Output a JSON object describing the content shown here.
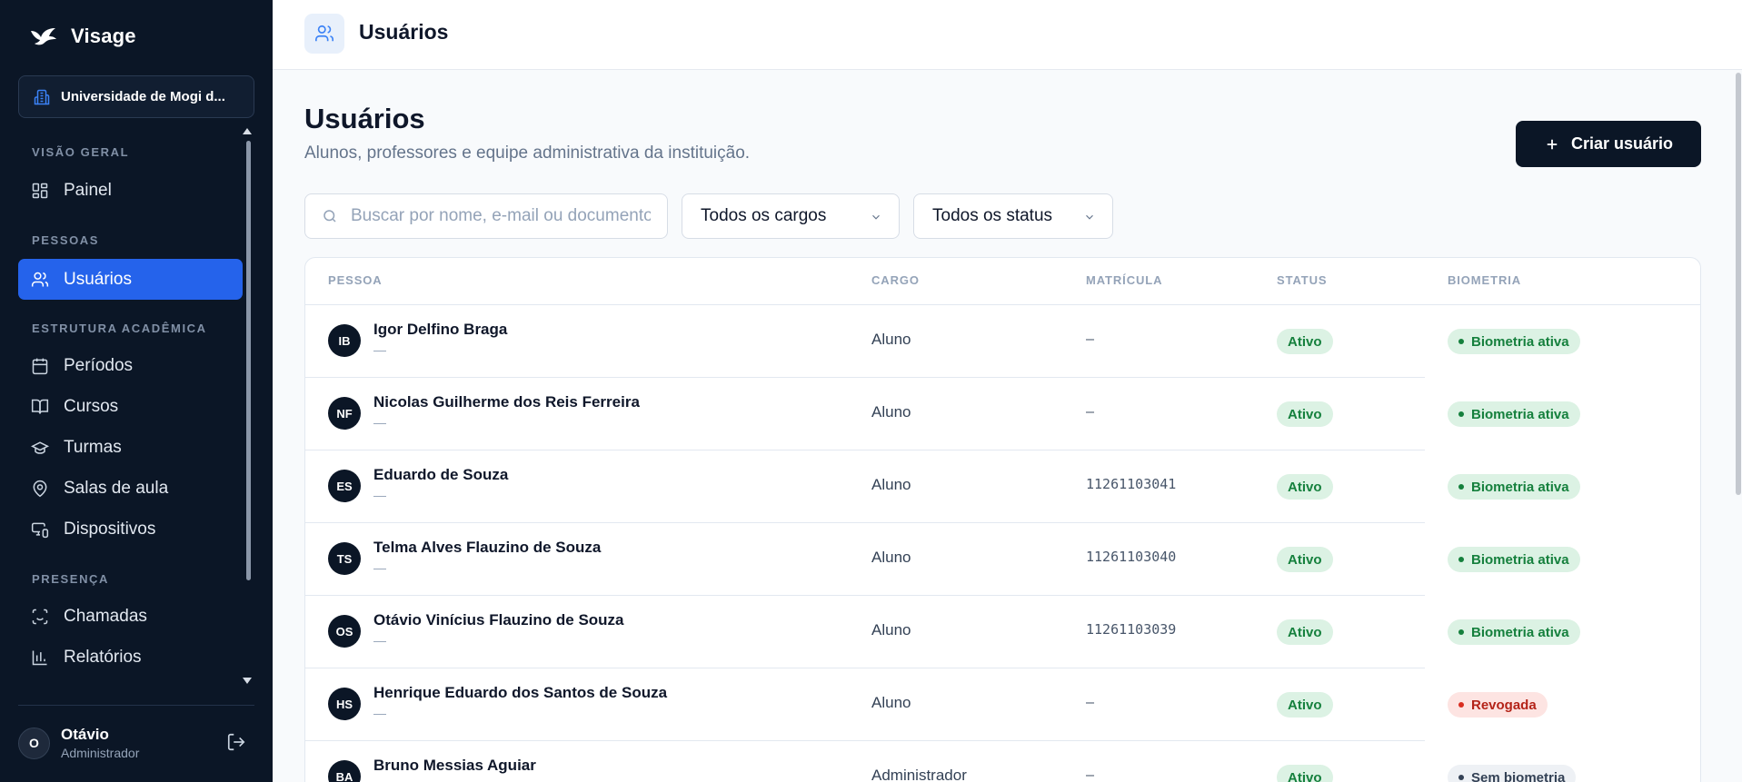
{
  "brand": {
    "name": "Visage"
  },
  "org": {
    "name": "Universidade de Mogi d..."
  },
  "sidebar": {
    "sections": [
      {
        "label": "VISÃO GERAL",
        "items": [
          {
            "label": "Painel",
            "icon": "grid-icon"
          }
        ]
      },
      {
        "label": "PESSOAS",
        "items": [
          {
            "label": "Usuários",
            "icon": "users-icon",
            "active": true
          }
        ]
      },
      {
        "label": "ESTRUTURA ACADÊMICA",
        "items": [
          {
            "label": "Períodos",
            "icon": "calendar-icon"
          },
          {
            "label": "Cursos",
            "icon": "book-icon"
          },
          {
            "label": "Turmas",
            "icon": "graduation-cap-icon"
          },
          {
            "label": "Salas de aula",
            "icon": "map-pin-icon"
          },
          {
            "label": "Dispositivos",
            "icon": "devices-icon"
          }
        ]
      },
      {
        "label": "PRESENÇA",
        "items": [
          {
            "label": "Chamadas",
            "icon": "face-scan-icon"
          },
          {
            "label": "Relatórios",
            "icon": "bar-chart-icon"
          }
        ]
      }
    ]
  },
  "user": {
    "initial": "O",
    "name": "Otávio",
    "role": "Administrador"
  },
  "topbar": {
    "title": "Usuários"
  },
  "page": {
    "title": "Usuários",
    "subtitle": "Alunos, professores e equipe administrativa da instituição.",
    "create_label": "Criar usuário"
  },
  "filters": {
    "search_placeholder": "Buscar por nome, e-mail ou documento",
    "cargo_value": "Todos os cargos",
    "status_value": "Todos os status"
  },
  "table": {
    "headers": {
      "pessoa": "PESSOA",
      "cargo": "CARGO",
      "matricula": "MATRÍCULA",
      "status": "STATUS",
      "biometria": "BIOMETRIA"
    },
    "rows": [
      {
        "initials": "IB",
        "name": "Igor Delfino Braga",
        "email": "—",
        "cargo": "Aluno",
        "matricula": "–",
        "status": "Ativo",
        "biometria": "Biometria ativa",
        "bio_kind": "ok"
      },
      {
        "initials": "NF",
        "name": "Nicolas Guilherme dos Reis Ferreira",
        "email": "—",
        "cargo": "Aluno",
        "matricula": "–",
        "status": "Ativo",
        "biometria": "Biometria ativa",
        "bio_kind": "ok"
      },
      {
        "initials": "ES",
        "name": "Eduardo de Souza",
        "email": "—",
        "cargo": "Aluno",
        "matricula": "11261103041",
        "status": "Ativo",
        "biometria": "Biometria ativa",
        "bio_kind": "ok"
      },
      {
        "initials": "TS",
        "name": "Telma Alves Flauzino de Souza",
        "email": "—",
        "cargo": "Aluno",
        "matricula": "11261103040",
        "status": "Ativo",
        "biometria": "Biometria ativa",
        "bio_kind": "ok"
      },
      {
        "initials": "OS",
        "name": "Otávio Vinícius Flauzino de Souza",
        "email": "—",
        "cargo": "Aluno",
        "matricula": "11261103039",
        "status": "Ativo",
        "biometria": "Biometria ativa",
        "bio_kind": "ok"
      },
      {
        "initials": "HS",
        "name": "Henrique Eduardo dos Santos de Souza",
        "email": "—",
        "cargo": "Aluno",
        "matricula": "–",
        "status": "Ativo",
        "biometria": "Revogada",
        "bio_kind": "revoked"
      },
      {
        "initials": "BA",
        "name": "Bruno Messias Aguiar",
        "email": "",
        "cargo": "Administrador",
        "matricula": "–",
        "status": "Ativo",
        "biometria": "Sem biometria",
        "bio_kind": "none"
      }
    ]
  },
  "colors": {
    "sidebar_bg": "#0b1626",
    "accent": "#2563eb",
    "success": "#15803d",
    "danger": "#b42318"
  }
}
